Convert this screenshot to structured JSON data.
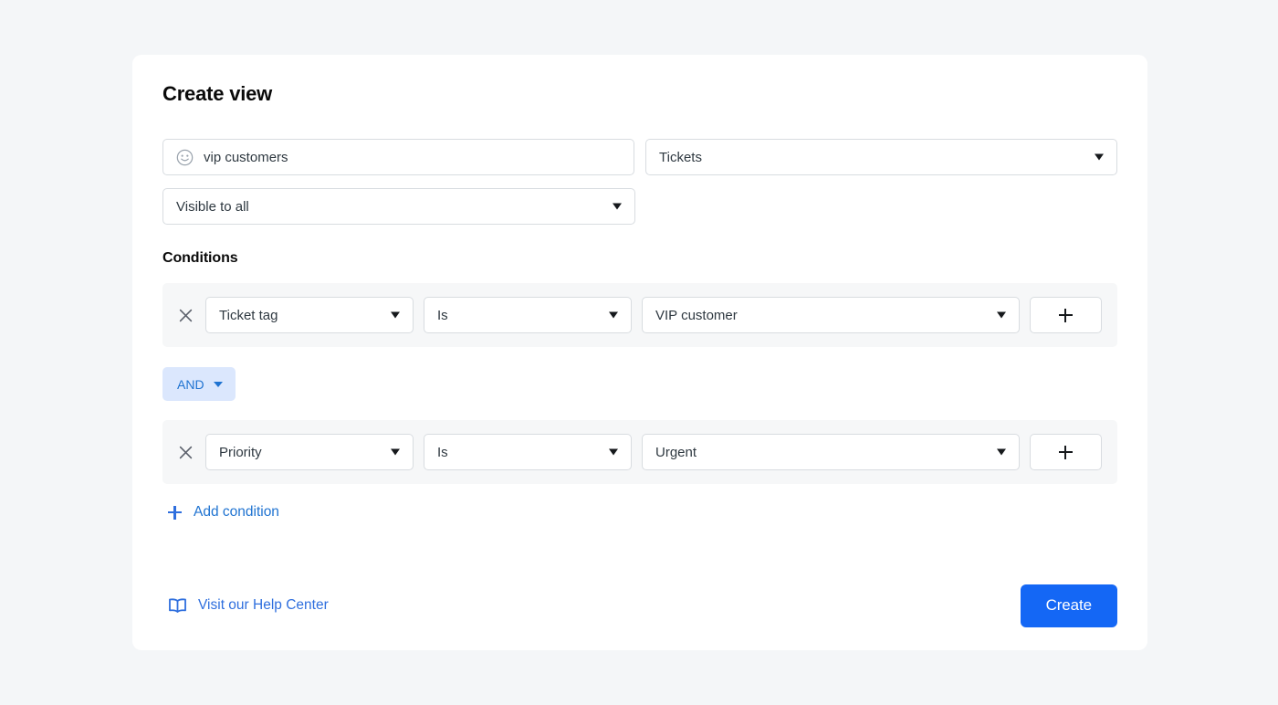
{
  "card": {
    "title": "Create view",
    "name_field": {
      "icon": "smiley-face-icon",
      "value": "vip customers",
      "placeholder": "View name"
    },
    "type_select": {
      "value": "Tickets",
      "icon": "chevron-down-icon"
    },
    "visibility_select": {
      "value": "Visible to all",
      "icon": "chevron-down-icon"
    },
    "conditions": {
      "heading": "Conditions",
      "rows": [
        {
          "remove_icon": "close-x-icon",
          "field": "Ticket tag",
          "operator": "Is",
          "value": "VIP customer",
          "add_icon": "plus-icon"
        },
        {
          "remove_icon": "close-x-icon",
          "field": "Priority",
          "operator": "Is",
          "value": "Urgent",
          "add_icon": "plus-icon"
        }
      ],
      "conjunction": {
        "label": "AND",
        "icon": "chevron-down-icon"
      },
      "add_condition": {
        "label": "Add condition",
        "icon": "plus-icon"
      }
    },
    "footer": {
      "help_link": {
        "label": "Visit our Help Center",
        "icon": "book-icon"
      },
      "submit_label": "Create"
    }
  },
  "colors": {
    "page_background": "#f4f6f8",
    "card_background": "#ffffff",
    "accent_blue": "#1467f5",
    "link_blue": "#2f6fde",
    "chip_background": "#dbe7fd",
    "chip_text": "#1f73d1",
    "row_background": "#f6f7f8",
    "border": "#d8dce0",
    "text_primary": "#2f3941"
  }
}
